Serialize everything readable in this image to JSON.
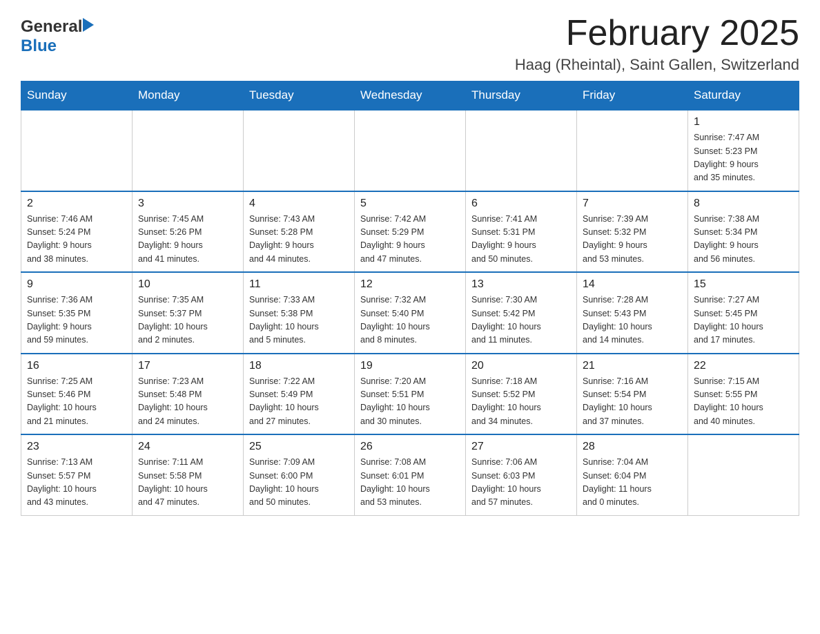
{
  "logo": {
    "general": "General",
    "blue": "Blue",
    "arrow": "▶"
  },
  "title": "February 2025",
  "location": "Haag (Rheintal), Saint Gallen, Switzerland",
  "weekdays": [
    "Sunday",
    "Monday",
    "Tuesday",
    "Wednesday",
    "Thursday",
    "Friday",
    "Saturday"
  ],
  "weeks": [
    {
      "days": [
        {
          "num": "",
          "info": ""
        },
        {
          "num": "",
          "info": ""
        },
        {
          "num": "",
          "info": ""
        },
        {
          "num": "",
          "info": ""
        },
        {
          "num": "",
          "info": ""
        },
        {
          "num": "",
          "info": ""
        },
        {
          "num": "1",
          "info": "Sunrise: 7:47 AM\nSunset: 5:23 PM\nDaylight: 9 hours\nand 35 minutes."
        }
      ]
    },
    {
      "days": [
        {
          "num": "2",
          "info": "Sunrise: 7:46 AM\nSunset: 5:24 PM\nDaylight: 9 hours\nand 38 minutes."
        },
        {
          "num": "3",
          "info": "Sunrise: 7:45 AM\nSunset: 5:26 PM\nDaylight: 9 hours\nand 41 minutes."
        },
        {
          "num": "4",
          "info": "Sunrise: 7:43 AM\nSunset: 5:28 PM\nDaylight: 9 hours\nand 44 minutes."
        },
        {
          "num": "5",
          "info": "Sunrise: 7:42 AM\nSunset: 5:29 PM\nDaylight: 9 hours\nand 47 minutes."
        },
        {
          "num": "6",
          "info": "Sunrise: 7:41 AM\nSunset: 5:31 PM\nDaylight: 9 hours\nand 50 minutes."
        },
        {
          "num": "7",
          "info": "Sunrise: 7:39 AM\nSunset: 5:32 PM\nDaylight: 9 hours\nand 53 minutes."
        },
        {
          "num": "8",
          "info": "Sunrise: 7:38 AM\nSunset: 5:34 PM\nDaylight: 9 hours\nand 56 minutes."
        }
      ]
    },
    {
      "days": [
        {
          "num": "9",
          "info": "Sunrise: 7:36 AM\nSunset: 5:35 PM\nDaylight: 9 hours\nand 59 minutes."
        },
        {
          "num": "10",
          "info": "Sunrise: 7:35 AM\nSunset: 5:37 PM\nDaylight: 10 hours\nand 2 minutes."
        },
        {
          "num": "11",
          "info": "Sunrise: 7:33 AM\nSunset: 5:38 PM\nDaylight: 10 hours\nand 5 minutes."
        },
        {
          "num": "12",
          "info": "Sunrise: 7:32 AM\nSunset: 5:40 PM\nDaylight: 10 hours\nand 8 minutes."
        },
        {
          "num": "13",
          "info": "Sunrise: 7:30 AM\nSunset: 5:42 PM\nDaylight: 10 hours\nand 11 minutes."
        },
        {
          "num": "14",
          "info": "Sunrise: 7:28 AM\nSunset: 5:43 PM\nDaylight: 10 hours\nand 14 minutes."
        },
        {
          "num": "15",
          "info": "Sunrise: 7:27 AM\nSunset: 5:45 PM\nDaylight: 10 hours\nand 17 minutes."
        }
      ]
    },
    {
      "days": [
        {
          "num": "16",
          "info": "Sunrise: 7:25 AM\nSunset: 5:46 PM\nDaylight: 10 hours\nand 21 minutes."
        },
        {
          "num": "17",
          "info": "Sunrise: 7:23 AM\nSunset: 5:48 PM\nDaylight: 10 hours\nand 24 minutes."
        },
        {
          "num": "18",
          "info": "Sunrise: 7:22 AM\nSunset: 5:49 PM\nDaylight: 10 hours\nand 27 minutes."
        },
        {
          "num": "19",
          "info": "Sunrise: 7:20 AM\nSunset: 5:51 PM\nDaylight: 10 hours\nand 30 minutes."
        },
        {
          "num": "20",
          "info": "Sunrise: 7:18 AM\nSunset: 5:52 PM\nDaylight: 10 hours\nand 34 minutes."
        },
        {
          "num": "21",
          "info": "Sunrise: 7:16 AM\nSunset: 5:54 PM\nDaylight: 10 hours\nand 37 minutes."
        },
        {
          "num": "22",
          "info": "Sunrise: 7:15 AM\nSunset: 5:55 PM\nDaylight: 10 hours\nand 40 minutes."
        }
      ]
    },
    {
      "days": [
        {
          "num": "23",
          "info": "Sunrise: 7:13 AM\nSunset: 5:57 PM\nDaylight: 10 hours\nand 43 minutes."
        },
        {
          "num": "24",
          "info": "Sunrise: 7:11 AM\nSunset: 5:58 PM\nDaylight: 10 hours\nand 47 minutes."
        },
        {
          "num": "25",
          "info": "Sunrise: 7:09 AM\nSunset: 6:00 PM\nDaylight: 10 hours\nand 50 minutes."
        },
        {
          "num": "26",
          "info": "Sunrise: 7:08 AM\nSunset: 6:01 PM\nDaylight: 10 hours\nand 53 minutes."
        },
        {
          "num": "27",
          "info": "Sunrise: 7:06 AM\nSunset: 6:03 PM\nDaylight: 10 hours\nand 57 minutes."
        },
        {
          "num": "28",
          "info": "Sunrise: 7:04 AM\nSunset: 6:04 PM\nDaylight: 11 hours\nand 0 minutes."
        },
        {
          "num": "",
          "info": ""
        }
      ]
    }
  ]
}
